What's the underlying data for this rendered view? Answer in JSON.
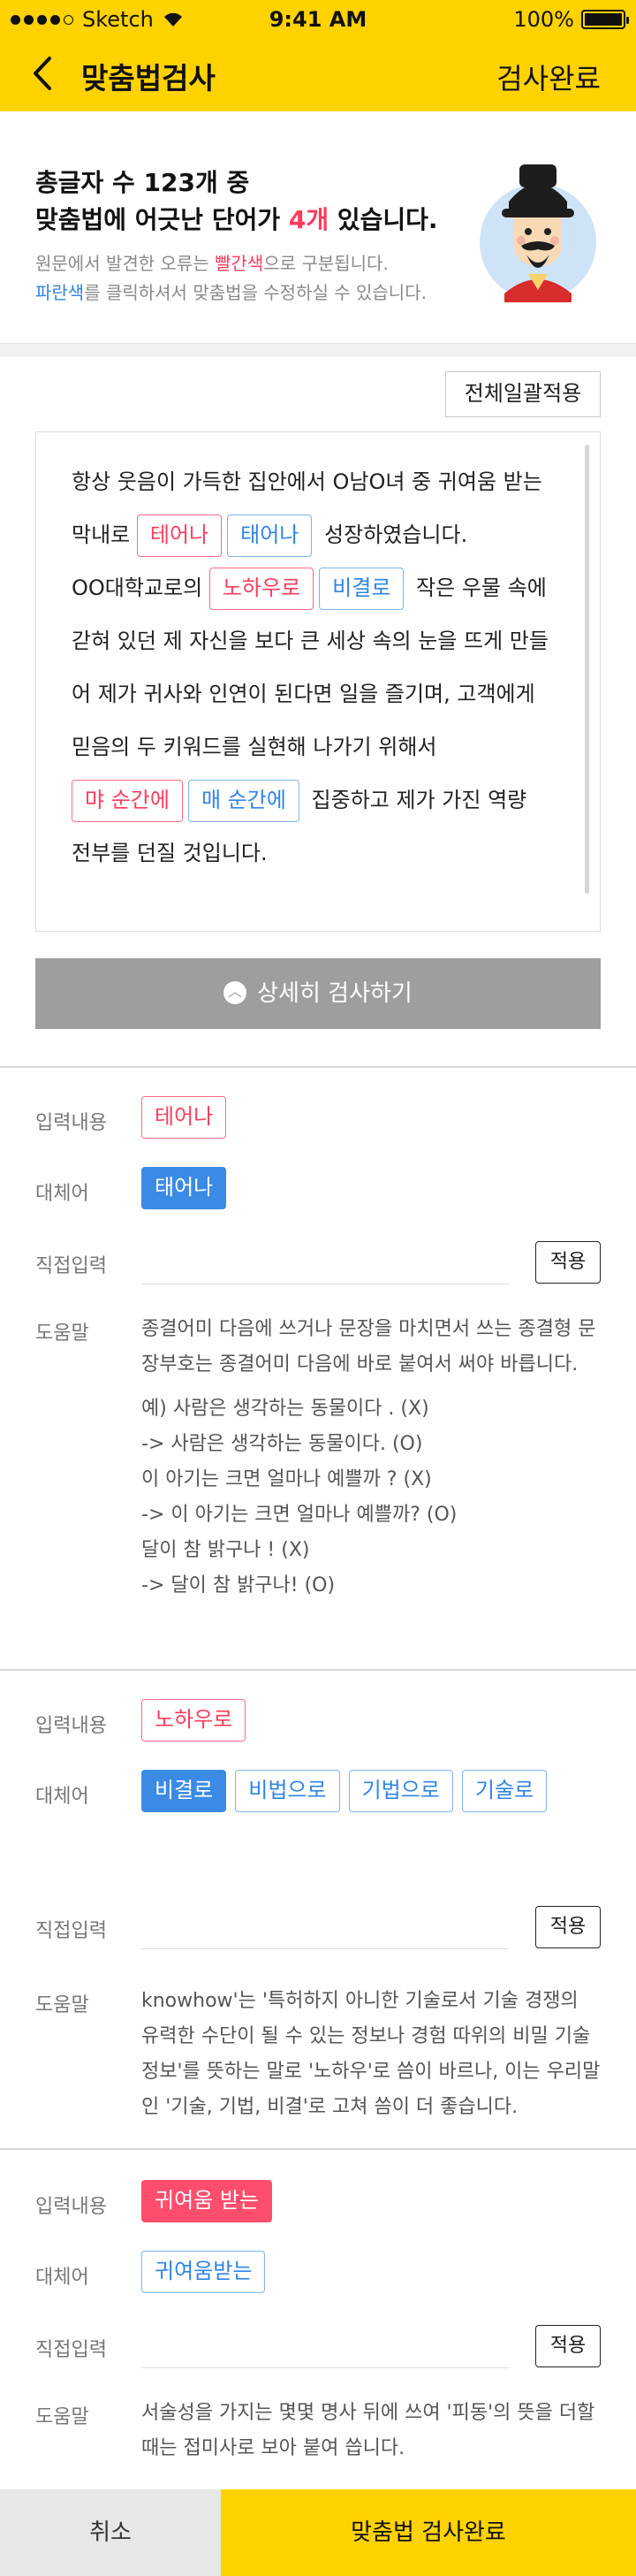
{
  "status": {
    "carrier": "Sketch",
    "time": "9:41 AM",
    "battery": "100%"
  },
  "header": {
    "title": "맞춤법검사",
    "done_label": "검사완료"
  },
  "summary": {
    "line1": "총글자 수 123개 중",
    "line2_pre": "맞춤법에 어긋난 단어가 ",
    "error_count": "4개",
    "line2_post": " 있습니다.",
    "desc1_pre": "원문에서 발견한 오류는 ",
    "desc1_red": "빨간색",
    "desc1_post": "으로 구분됩니다.",
    "desc2_blue": "파란색",
    "desc2_post": "를 클릭하셔서 맞춤법을 수정하실 수 있습니다."
  },
  "apply_all_label": "전체일괄적용",
  "text_content": {
    "l1": "항상 웃음이 가득한 집안에서 O남O녀 중 귀여움 받는",
    "l2_pre": "막내로",
    "l2_red": "테어나",
    "l2_blue": "태어나",
    "l2_post": "성장하였습니다.",
    "l3_pre": "OO대학교로의",
    "l3_red": "노하우로",
    "l3_blue": "비결로",
    "l3_post": "작은 우물 속에",
    "l4": "갇혀 있던 제 자신을 보다 큰 세상 속의 눈을 뜨게 만들",
    "l5": "어 제가 귀사와 인연이 된다면 일을 즐기며, 고객에게",
    "l6": "믿음의 두 키워드를 실현해 나가기 위해서",
    "l7_red": "먀 순간에",
    "l7_blue": "매 순간에",
    "l7_post": "집중하고 제가 가진 역량",
    "l8": "전부를 던질 것입니다."
  },
  "detail_button": {
    "icon": "chevron-up-icon",
    "label": "상세히 검사하기"
  },
  "labels": {
    "input": "입력내용",
    "replace": "대체어",
    "direct": "직접입력",
    "help": "도움말",
    "apply": "적용"
  },
  "sections": [
    {
      "input": "테어나",
      "replacements": [
        "태어나"
      ],
      "help": [
        "종결어미 다음에 쓰거나 문장을 마치면서 쓰는 종결형 문장부호는 종결어미 다음에 바로 붙여서 써야 바릅니다.",
        "예) 사람은 생각하는 동물이다 . (X)",
        "-> 사람은 생각하는 동물이다. (O)",
        "이 아기는 크면 얼마나 예쁠까 ? (X)",
        "-> 이 아기는 크면 얼마나 예쁠까? (O)",
        "달이 참 밝구나 ! (X)",
        "-> 달이 참 밝구나! (O)"
      ]
    },
    {
      "input": "노하우로",
      "replacements": [
        "비결로",
        "비법으로",
        "기법으로",
        "기술로"
      ],
      "help": [
        "knowhow'는 '특허하지 아니한 기술로서 기술 경쟁의 유력한 수단이 될 수 있는 정보나 경험 따위의 비밀 기술 정보'를 뜻하는 말로 '노하우'로 씀이 바르나, 이는 우리말인 '기술, 기법, 비결'로 고쳐 씀이 더 좋습니다."
      ]
    },
    {
      "input": "귀여움 받는",
      "replacements": [
        "귀여움받는"
      ],
      "help": [
        "서술성을 가지는 몇몇 명사 뒤에 쓰여 '피동'의 뜻을 더할 때는 접미사로 보아 붙여 씁니다."
      ]
    }
  ],
  "bottom": {
    "cancel_label": "취소",
    "done_label": "맞춤법 검사완료"
  },
  "colors": {
    "brand": "#ffd200",
    "error": "#ff3b5c",
    "correct": "#2f84e6"
  }
}
